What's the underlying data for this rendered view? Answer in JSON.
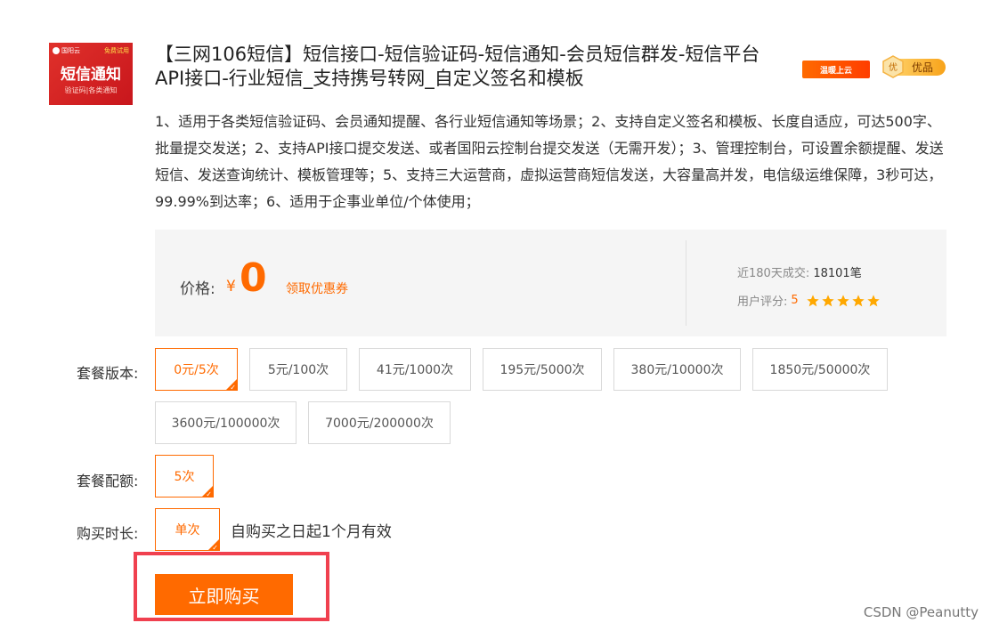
{
  "product": {
    "thumb": {
      "brand": "国阳云",
      "tag": "免费试用",
      "main": "短信通知",
      "sub": "验证码|各类通知"
    },
    "title": "【三网106短信】短信接口-短信验证码-短信通知-会员短信群发-短信平台API接口-行业短信_支持携号转网_自定义签名和模板",
    "badges": {
      "cloud": "温暖上云",
      "premium_icon": "优",
      "premium": "优品"
    },
    "description": "1、适用于各类短信验证码、会员通知提醒、各行业短信通知等场景；2、支持自定义签名和模板、长度自适应，可达500字、批量提交发送；2、支持API接口提交发送、或者国阳云控制台提交发送（无需开发）；3、管理控制台，可设置余额提醒、发送短信、发送查询统计、模板管理等；5、支持三大运营商，虚拟运营商短信发送，大容量高并发，电信级运维保障，3秒可达，99.99%到达率；6、适用于企事业单位/个体使用；"
  },
  "price": {
    "label": "价格:",
    "currency": "¥",
    "value": "0",
    "coupon": "领取优惠券",
    "sales_label": "近180天成交:",
    "sales_value": "18101笔",
    "rating_label": "用户评分:",
    "rating_value": "5",
    "rating_stars": 5
  },
  "plans": {
    "label": "套餐版本:",
    "options": [
      "0元/5次",
      "5元/100次",
      "41元/1000次",
      "195元/5000次",
      "380元/10000次",
      "1850元/50000次",
      "3600元/100000次",
      "7000元/200000次"
    ],
    "selected": "0元/5次"
  },
  "quota": {
    "label": "套餐配额:",
    "value": "5次"
  },
  "duration": {
    "label": "购买时长:",
    "value": "单次",
    "note": "自购买之日起1个月有效"
  },
  "buy_button": "立即购买",
  "watermark": "CSDN @Peanutty",
  "colors": {
    "accent": "#ff6a00",
    "highlight": "#f0404f",
    "thumb_bg": "#d61f1f"
  }
}
